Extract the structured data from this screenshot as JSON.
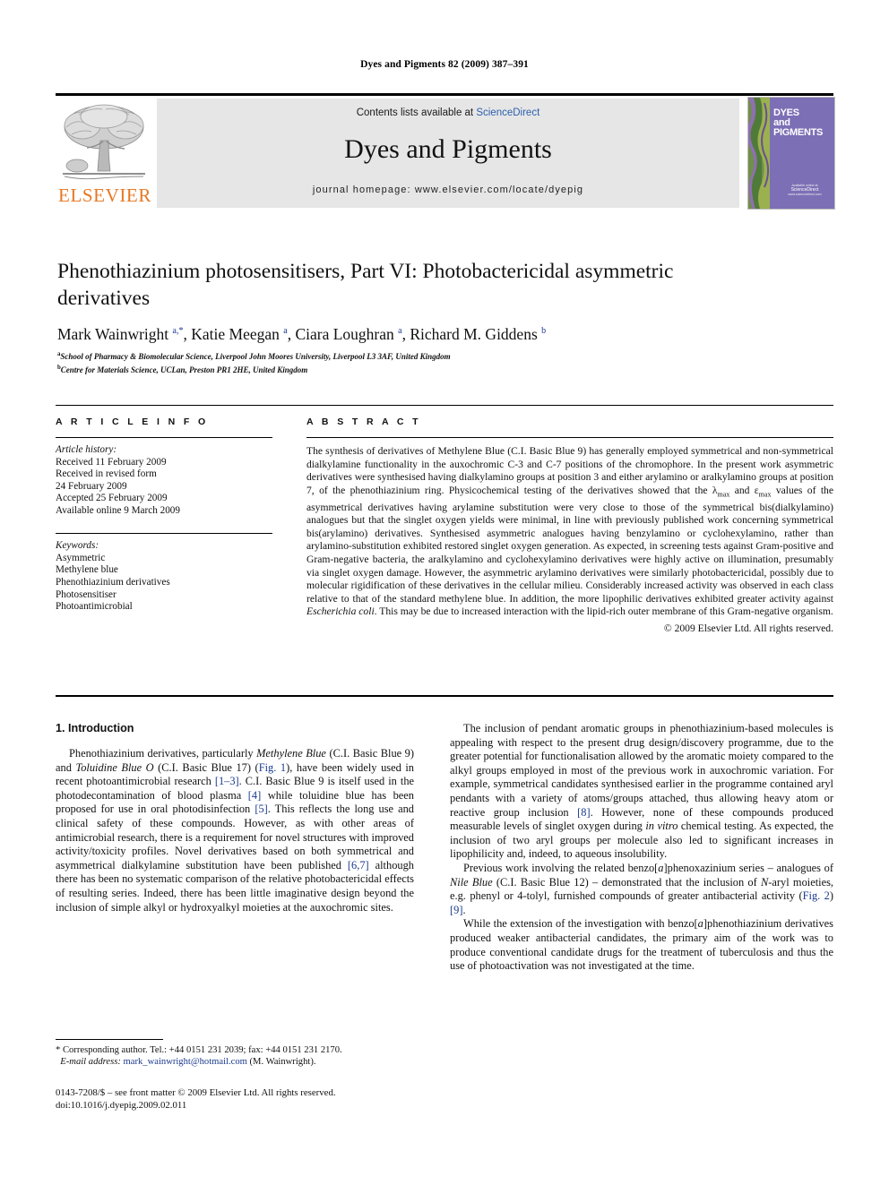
{
  "running_head": "Dyes and Pigments 82 (2009) 387–391",
  "masthead": {
    "publisher_name": "ELSEVIER",
    "contents_prefix": "Contents lists available at ",
    "contents_link": "ScienceDirect",
    "journal_title": "Dyes and Pigments",
    "homepage": "journal homepage: www.elsevier.com/locate/dyepig",
    "cover": {
      "line1": "DYES",
      "line2": "and",
      "line3": "PIGMENTS",
      "foot_small": "Available online at",
      "foot_sd": "ScienceDirect",
      "foot_url": "www.sciencedirect.com"
    }
  },
  "article": {
    "title": "Phenothiazinium photosensitisers, Part VI: Photobactericidal asymmetric derivatives",
    "authors_html": "Mark Wainwright <sup>a,*</sup>, Katie Meegan <sup>a</sup>, Ciara Loughran <sup>a</sup>, Richard M. Giddens <sup>b</sup>",
    "affiliations": [
      "School of Pharmacy & Biomolecular Science, Liverpool John Moores University, Liverpool L3 3AF, United Kingdom",
      "Centre for Materials Science, UCLan, Preston PR1 2HE, United Kingdom"
    ],
    "affiliation_marks": [
      "a",
      "b"
    ]
  },
  "article_info": {
    "heading": "A R T I C L E  I N F O",
    "history_label": "Article history:",
    "history": [
      "Received 11 February 2009",
      "Received in revised form",
      "24 February 2009",
      "Accepted 25 February 2009",
      "Available online 9 March 2009"
    ],
    "keywords_label": "Keywords:",
    "keywords": [
      "Asymmetric",
      "Methylene blue",
      "Phenothiazinium derivatives",
      "Photosensitiser",
      "Photoantimicrobial"
    ]
  },
  "abstract": {
    "heading": "A B S T R A C T",
    "text_html": "The synthesis of derivatives of Methylene Blue (C.I. Basic Blue 9) has generally employed symmetrical and non-symmetrical dialkylamine functionality in the auxochromic C-3 and C-7 positions of the chromophore. In the present work asymmetric derivatives were synthesised having dialkylamino groups at position 3 and either arylamino or aralkylamino groups at position 7, of the phenothiazinium ring. Physicochemical testing of the derivatives showed that the &lambda;<sub>max</sub> and &epsilon;<sub>max</sub> values of the asymmetrical derivatives having arylamine substitution were very close to those of the symmetrical bis(dialkylamino) analogues but that the singlet oxygen yields were minimal, in line with previously published work concerning symmetrical bis(arylamino) derivatives. Synthesised asymmetric analogues having benzylamino or cyclohexylamino, rather than arylamino-substitution exhibited restored singlet oxygen generation. As expected, in screening tests against Gram-positive and Gram-negative bacteria, the aralkylamino and cyclohexylamino derivatives were highly active on illumination, presumably via singlet oxygen damage. However, the asymmetric arylamino derivatives were similarly photobactericidal, possibly due to molecular rigidification of these derivatives in the cellular milieu. Considerably increased activity was observed in each class relative to that of the standard methylene blue. In addition, the more lipophilic derivatives exhibited greater activity against <i>Escherichia coli</i>. This may be due to increased interaction with the lipid-rich outer membrane of this Gram-negative organism.",
    "copyright": "© 2009 Elsevier Ltd. All rights reserved."
  },
  "introduction": {
    "heading": "1. Introduction",
    "left_paragraphs_html": [
      "Phenothiazinium derivatives, particularly <i>Methylene Blue</i> (C.I. Basic Blue 9) and <i>Toluidine Blue O</i> (C.I. Basic Blue 17) (<span class=\"ref\">Fig. 1</span>), have been widely used in recent photoantimicrobial research <span class=\"ref\">[1–3]</span>. C.I. Basic Blue 9 is itself used in the photodecontamination of blood plasma <span class=\"ref\">[4]</span> while toluidine blue has been proposed for use in oral photodisinfection <span class=\"ref\">[5]</span>. This reflects the long use and clinical safety of these compounds. However, as with other areas of antimicrobial research, there is a requirement for novel structures with improved activity/toxicity profiles. Novel derivatives based on both symmetrical and asymmetrical dialkylamine substitution have been published <span class=\"ref\">[6,7]</span> although there has been no systematic comparison of the relative photobactericidal effects of resulting series. Indeed, there has been little imaginative design beyond the inclusion of simple alkyl or hydroxyalkyl moieties at the auxochromic sites."
    ],
    "right_paragraphs_html": [
      "The inclusion of pendant aromatic groups in phenothiazinium-based molecules is appealing with respect to the present drug design/discovery programme, due to the greater potential for functionalisation allowed by the aromatic moiety compared to the alkyl groups employed in most of the previous work in auxochromic variation. For example, symmetrical candidates synthesised earlier in the programme contained aryl pendants with a variety of atoms/groups attached, thus allowing heavy atom or reactive group inclusion <span class=\"ref\">[8]</span>. However, none of these compounds produced measurable levels of singlet oxygen during <i>in vitro</i> chemical testing. As expected, the inclusion of two aryl groups per molecule also led to significant increases in lipophilicity and, indeed, to aqueous insolubility.",
      "Previous work involving the related benzo[<i>a</i>]phenoxazinium series – analogues of <i>Nile Blue</i> (C.I. Basic Blue 12) – demonstrated that the inclusion of <i>N</i>-aryl moieties, e.g. phenyl or 4-tolyl, furnished compounds of greater antibacterial activity (<span class=\"ref\">Fig. 2</span>) <span class=\"ref\">[9]</span>.",
      "While the extension of the investigation with benzo[<i>a</i>]phenothiazinium derivatives produced weaker antibacterial candidates, the primary aim of the work was to produce conventional candidate drugs for the treatment of tuberculosis and thus the use of photoactivation was not investigated at the time."
    ]
  },
  "footnotes": {
    "corresponding_html": "* Corresponding author. Tel.: +44 0151 231 2039; fax: +44 0151 231 2170.",
    "email_label": "E-mail address:",
    "email": "mark_wainwright@hotmail.com",
    "email_suffix": "(M. Wainwright).",
    "imprint_line1": "0143-7208/$ – see front matter © 2009 Elsevier Ltd. All rights reserved.",
    "imprint_line2": "doi:10.1016/j.dyepig.2009.02.011"
  },
  "colors": {
    "link_blue": "#1b3a8f",
    "sciencedirect_blue": "#2b5fad",
    "elsevier_orange": "#E87722",
    "banner_grey": "#e6e6e6",
    "cover_purple": "#7c6fb5"
  }
}
